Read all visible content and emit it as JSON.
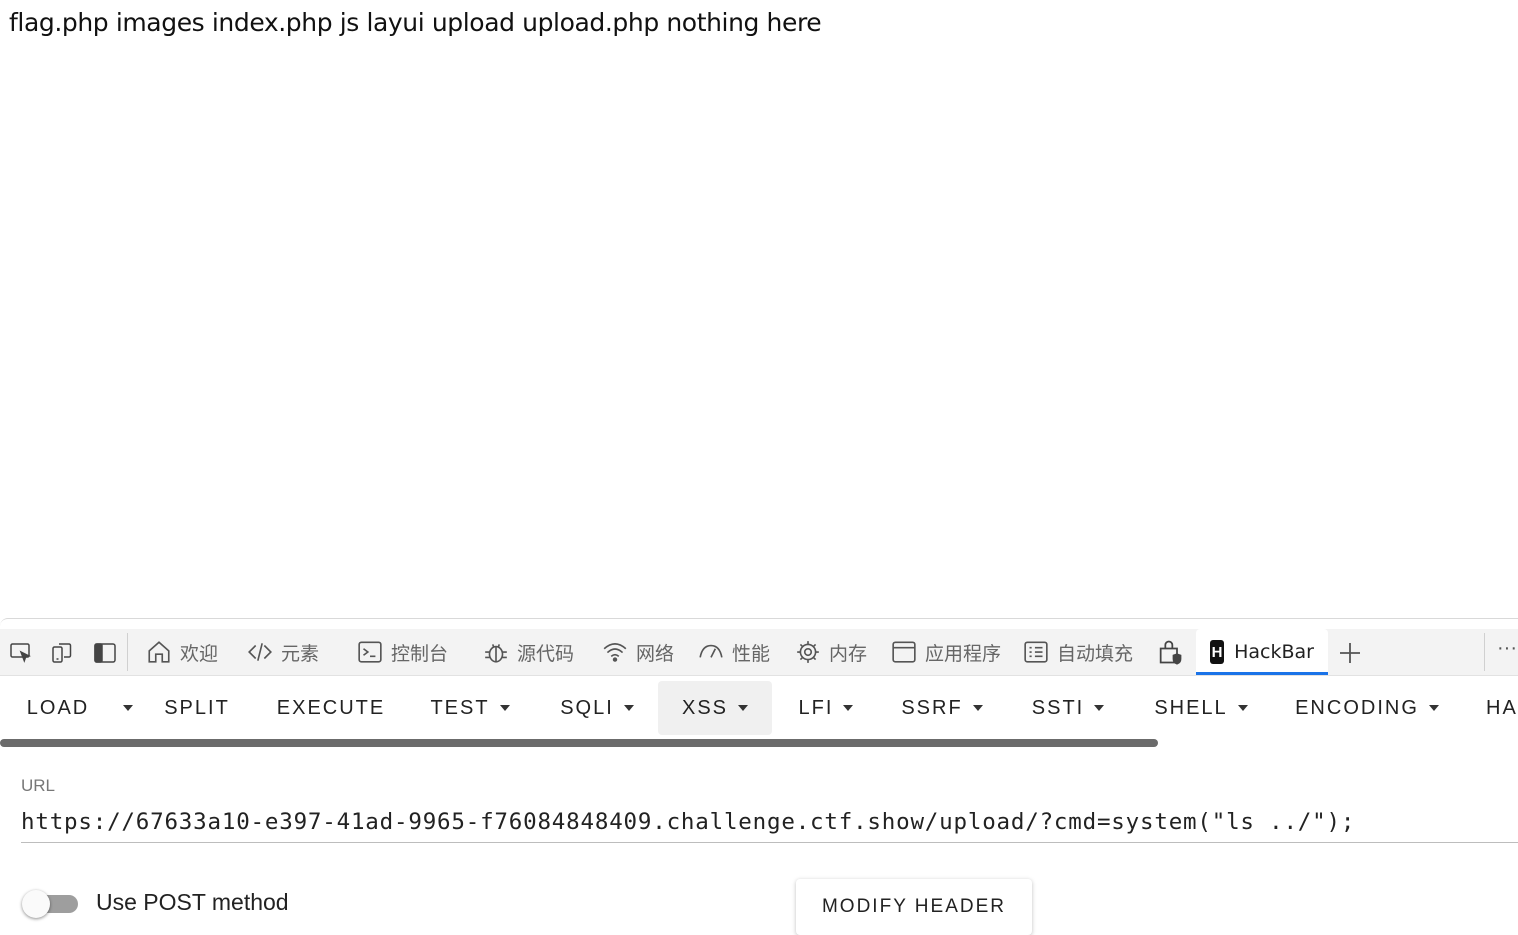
{
  "page": {
    "output_text": "flag.php images index.php js layui upload upload.php nothing here"
  },
  "devtools": {
    "tabs": [
      {
        "label": "欢迎",
        "icon": "home-icon"
      },
      {
        "label": "元素",
        "icon": "code-icon"
      },
      {
        "label": "控制台",
        "icon": "console-icon"
      },
      {
        "label": "源代码",
        "icon": "bug-icon"
      },
      {
        "label": "网络",
        "icon": "wifi-icon"
      },
      {
        "label": "性能",
        "icon": "gauge-icon"
      },
      {
        "label": "内存",
        "icon": "chip-icon"
      },
      {
        "label": "应用程序",
        "icon": "window-icon"
      },
      {
        "label": "自动填充",
        "icon": "list-icon"
      },
      {
        "label": "HackBar",
        "icon": "hackbar-logo-icon",
        "logo_letter": "H",
        "active": true
      }
    ],
    "more_label": "···"
  },
  "hackbar": {
    "toolbar": {
      "load": "LOAD",
      "split": "SPLIT",
      "execute": "EXECUTE",
      "test": "TEST",
      "sqli": "SQLI",
      "xss": "XSS",
      "lfi": "LFI",
      "ssrf": "SSRF",
      "ssti": "SSTI",
      "shell": "SHELL",
      "encoding": "ENCODING",
      "hash": "HA",
      "active": "XSS"
    },
    "scroll_fraction": 0.763,
    "url_label": "URL",
    "url_value": "https://67633a10-e397-41ad-9965-f76084848409.challenge.ctf.show/upload/?cmd=system(\"ls ../\");",
    "post_label": "Use POST method",
    "post_enabled": false,
    "modify_header_label": "MODIFY HEADER"
  },
  "colors": {
    "accent": "#1a73e8",
    "tab_bar_bg": "#f3f3f3"
  }
}
